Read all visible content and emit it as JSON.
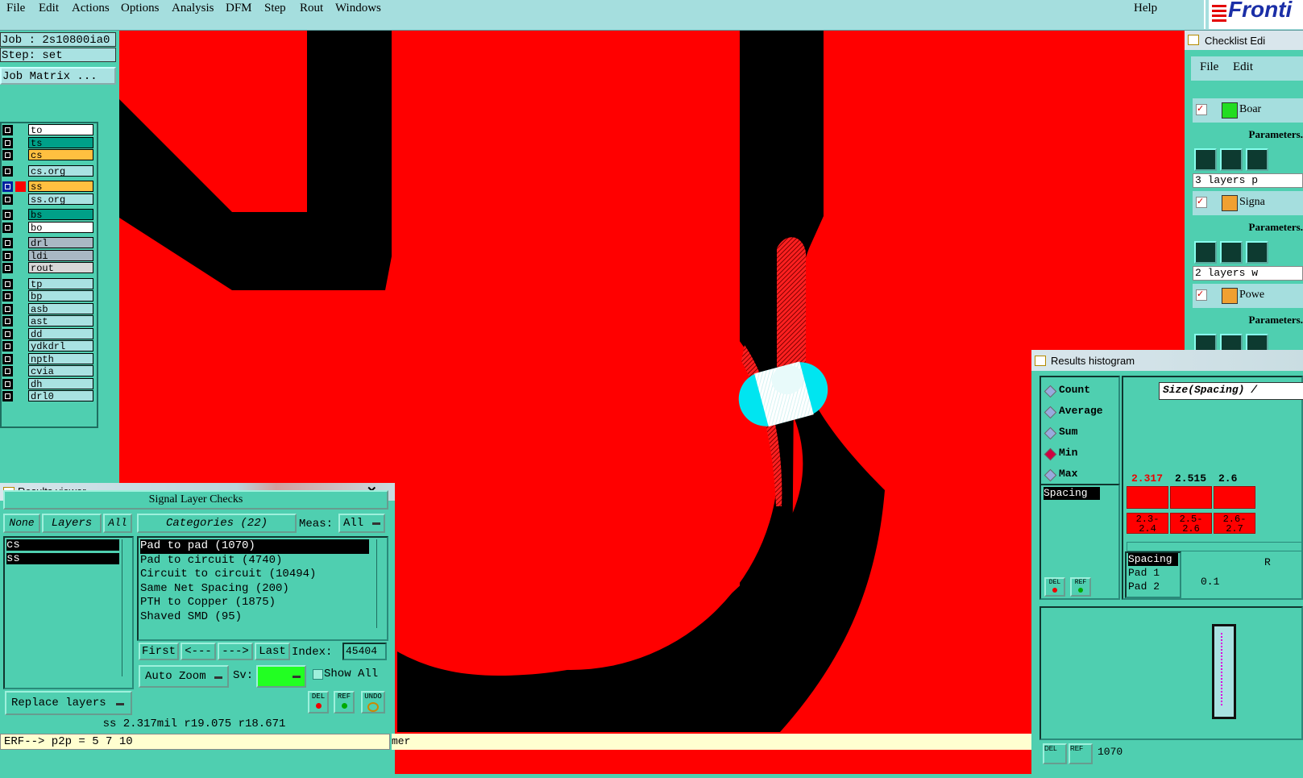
{
  "menubar": {
    "items": [
      "File",
      "Edit",
      "Actions",
      "Options",
      "Analysis",
      "DFM",
      "Step",
      "Rout",
      "Windows"
    ],
    "help": "Help",
    "logo": "Fronti"
  },
  "left": {
    "job": "Job : 2s10800ia0",
    "step": "Step: set",
    "job_matrix": "Job Matrix ...",
    "layers": [
      {
        "name": "to",
        "color": "#ffffff"
      },
      {
        "name": "ts",
        "color": "#00a088"
      },
      {
        "name": "cs",
        "color": "#ffc040"
      },
      {
        "name": "cs.org",
        "color": "#a9e2e2"
      },
      {
        "name": "ss",
        "color": "#ffc040",
        "active": true
      },
      {
        "name": "ss.org",
        "color": "#a9e2e2"
      },
      {
        "name": "bs",
        "color": "#00a088"
      },
      {
        "name": "bo",
        "color": "#ffffff"
      },
      {
        "name": "drl",
        "color": "#a9b8c4"
      },
      {
        "name": "ldi",
        "color": "#a9b8c4"
      },
      {
        "name": "rout",
        "color": "#d8d8d8"
      },
      {
        "name": "tp",
        "color": "#a9e2e2"
      },
      {
        "name": "bp",
        "color": "#a9e2e2"
      },
      {
        "name": "asb",
        "color": "#a9e2e2"
      },
      {
        "name": "ast",
        "color": "#a9e2e2"
      },
      {
        "name": "dd",
        "color": "#a9e2e2"
      },
      {
        "name": "ydkdrl",
        "color": "#a9e2e2"
      },
      {
        "name": "npth",
        "color": "#a9e2e2"
      },
      {
        "name": "cvia",
        "color": "#a9e2e2"
      },
      {
        "name": "dh",
        "color": "#a9e2e2"
      },
      {
        "name": "drl0",
        "color": "#a9e2e2"
      }
    ]
  },
  "results_viewer": {
    "title": "Results viewer",
    "header": "Signal Layer Checks",
    "none": "None",
    "layers": "Layers",
    "all": "All",
    "layer_items": [
      "cs",
      "ss"
    ],
    "categories": "Categories (22)",
    "meas_label": "Meas:",
    "meas_value": "All",
    "category_items": [
      "Pad to pad (1070)",
      "Pad to circuit (4740)",
      "Circuit to circuit (10494)",
      "Same Net Spacing (200)",
      "PTH to Copper (1875)",
      "Shaved SMD (95)"
    ],
    "first": "First",
    "prev": "<---",
    "next": "--->",
    "last": "Last",
    "index_label": "Index:",
    "index_value": "45404",
    "auto_zoom": "Auto Zoom",
    "sv": "Sv:",
    "show_all": "Show All",
    "replace_layers": "Replace layers",
    "del": "DEL",
    "ref": "REF",
    "undo": "UNDO",
    "status": "ss 2.317mil  r19.075  r18.671",
    "close": "✕"
  },
  "command_line": "ERF--> p2p = 5 7 10",
  "bottom_fragment": "mer",
  "checklist": {
    "title": "Checklist Edi",
    "file": "File",
    "edit": "Edit",
    "items": [
      {
        "label": "Boar",
        "params": "Parameters.",
        "info": "3 layers p",
        "icon_color": "#22dd22"
      },
      {
        "label": "Signa",
        "params": "Parameters.",
        "info": "2 layers w",
        "icon_color": "#f0a030"
      },
      {
        "label": "Powe",
        "params": "Parameters.",
        "info": "",
        "icon_color": "#f0a030"
      }
    ]
  },
  "histogram": {
    "title": "Results histogram",
    "modes": [
      "Count",
      "Average",
      "Sum",
      "Min",
      "Max"
    ],
    "selected_mode": "Min",
    "size_label": "Size(Spacing) /",
    "spacing_item": "Spacing",
    "bars": [
      {
        "value": "2.317",
        "range": "2.3-\n2.4"
      },
      {
        "value": "2.515",
        "range": "2.5-\n2.6"
      },
      {
        "value": "2.6",
        "range": "2.6-\n2.7"
      }
    ],
    "detail_items": [
      "Spacing",
      "Pad 1",
      "Pad 2"
    ],
    "detail_value": "0.1",
    "detail_r": "R",
    "del": "DEL",
    "ref": "REF",
    "bottom_value": "1070"
  }
}
